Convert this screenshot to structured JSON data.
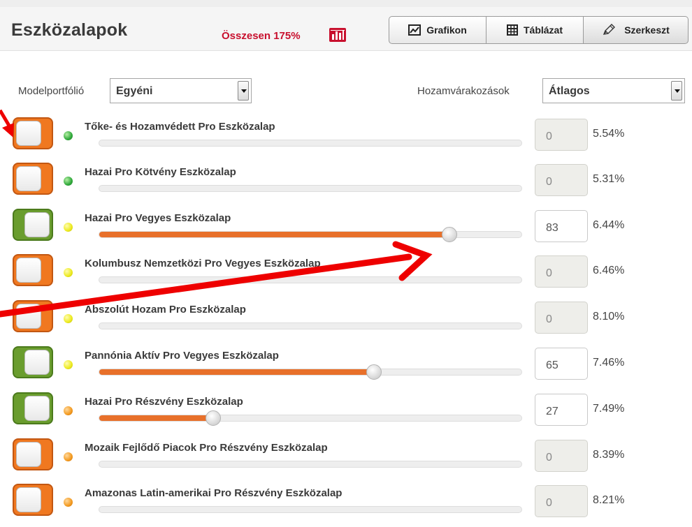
{
  "header": {
    "title": "Eszközalapok",
    "total_label": "Összesen 175%",
    "buttons": [
      {
        "label": "Grafikon",
        "icon": "line-chart-icon"
      },
      {
        "label": "Táblázat",
        "icon": "table-icon"
      },
      {
        "label": "Szerkeszt",
        "icon": "pencil-icon"
      }
    ]
  },
  "filters": {
    "portfolio_label": "Modelportfólió",
    "portfolio_value": "Egyéni",
    "returns_label": "Hozamvárakozások",
    "returns_value": "Átlagos"
  },
  "colors": {
    "accent": "#e8702a",
    "toggle_on": "#6a9d2e",
    "toggle_off": "#f07820",
    "total_red": "#c8102e"
  },
  "funds": [
    {
      "name": "Tőke- és Hozamvédett Pro Eszközalap",
      "enabled": false,
      "risk": "green",
      "allocation": "0",
      "slider_percent": 0,
      "return": "5.54%"
    },
    {
      "name": "Hazai Pro Kötvény Eszközalap",
      "enabled": false,
      "risk": "green",
      "allocation": "0",
      "slider_percent": 0,
      "return": "5.31%"
    },
    {
      "name": "Hazai Pro Vegyes Eszközalap",
      "enabled": true,
      "risk": "yellow",
      "allocation": "83",
      "slider_percent": 83,
      "return": "6.44%"
    },
    {
      "name": "Kolumbusz Nemzetközi Pro Vegyes Eszközalap",
      "enabled": false,
      "risk": "yellow",
      "allocation": "0",
      "slider_percent": 0,
      "return": "6.46%"
    },
    {
      "name": "Abszolút Hozam Pro Eszközalap",
      "enabled": false,
      "risk": "yellow",
      "allocation": "0",
      "slider_percent": 0,
      "return": "8.10%"
    },
    {
      "name": "Pannónia Aktív Pro Vegyes Eszközalap",
      "enabled": true,
      "risk": "yellow",
      "allocation": "65",
      "slider_percent": 65,
      "return": "7.46%"
    },
    {
      "name": "Hazai Pro Részvény Eszközalap",
      "enabled": true,
      "risk": "orange",
      "allocation": "27",
      "slider_percent": 27,
      "return": "7.49%"
    },
    {
      "name": "Mozaik Fejlődő Piacok Pro Részvény Eszközalap",
      "enabled": false,
      "risk": "orange",
      "allocation": "0",
      "slider_percent": 0,
      "return": "8.39%"
    },
    {
      "name": "Amazonas Latin-amerikai Pro Részvény Eszközalap",
      "enabled": false,
      "risk": "orange",
      "allocation": "0",
      "slider_percent": 0,
      "return": "8.21%"
    }
  ]
}
